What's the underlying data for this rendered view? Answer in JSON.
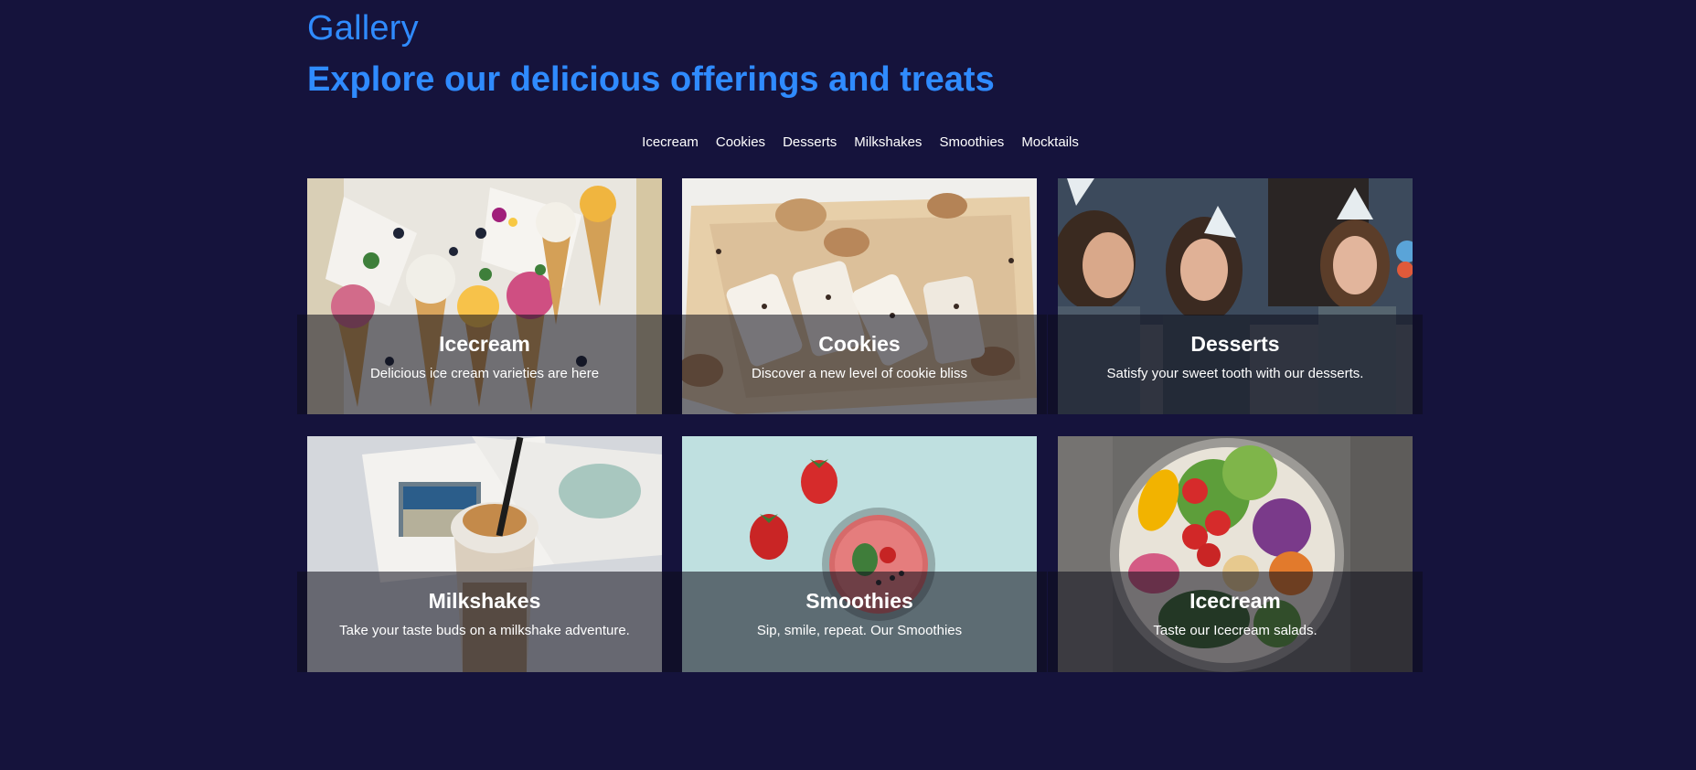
{
  "header": {
    "title": "Gallery",
    "subtitle": "Explore our delicious offerings and treats"
  },
  "nav": {
    "items": [
      "Icecream",
      "Cookies",
      "Desserts",
      "Milkshakes",
      "Smoothies",
      "Mocktails"
    ]
  },
  "cards": [
    {
      "title": "Icecream",
      "description": "Delicious ice cream varieties are here"
    },
    {
      "title": "Cookies",
      "description": "Discover a new level of cookie bliss"
    },
    {
      "title": "Desserts",
      "description": "Satisfy your sweet tooth with our desserts."
    },
    {
      "title": "Milkshakes",
      "description": "Take your taste buds on a milkshake adventure."
    },
    {
      "title": "Smoothies",
      "description": "Sip, smile, repeat. Our Smoothies"
    },
    {
      "title": "Icecream",
      "description": "Taste our Icecream salads."
    }
  ],
  "colors": {
    "background": "#15133c",
    "accent": "#2f8bff",
    "text": "#ffffff"
  }
}
